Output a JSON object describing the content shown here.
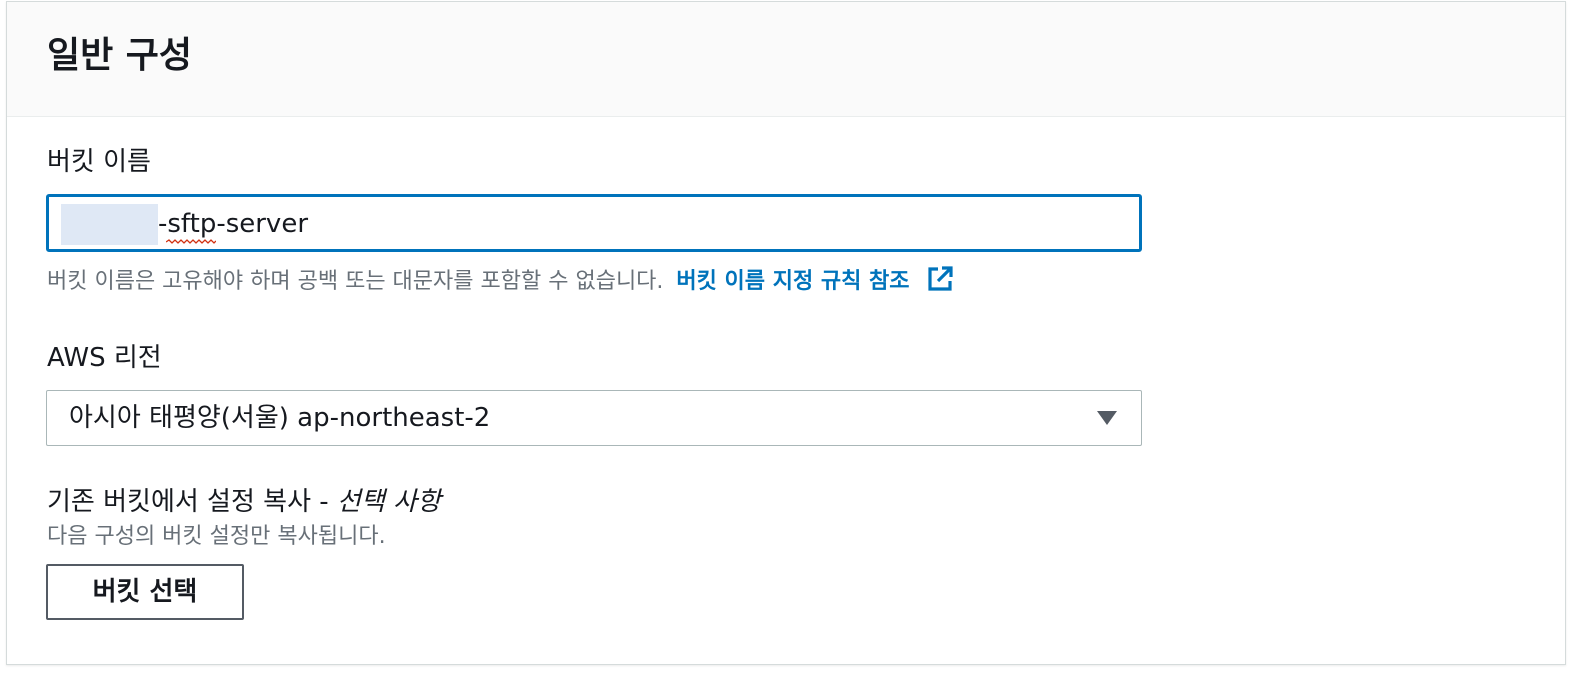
{
  "panel": {
    "title": "일반 구성"
  },
  "bucket_name": {
    "label": "버킷 이름",
    "value": "-sftp-server",
    "hint": "버킷 이름은 고유해야 하며 공백 또는 대문자를 포함할 수 없습니다.",
    "link_label": "버킷 이름 지정 규칙 참조",
    "link_icon": "external-link-icon"
  },
  "region": {
    "label": "AWS 리전",
    "selected": "아시아 태평양(서울) ap-northeast-2",
    "caret_icon": "caret-down-icon"
  },
  "copy_settings": {
    "label": "기존 버킷에서 설정 복사 -",
    "optional": "선택 사항",
    "description": "다음 구성의 버킷 설정만 복사됩니다.",
    "button_label": "버킷 선택"
  },
  "colors": {
    "accent": "#0073bb",
    "text": "#16191f",
    "muted": "#687078",
    "header_bg": "#fafafa"
  }
}
